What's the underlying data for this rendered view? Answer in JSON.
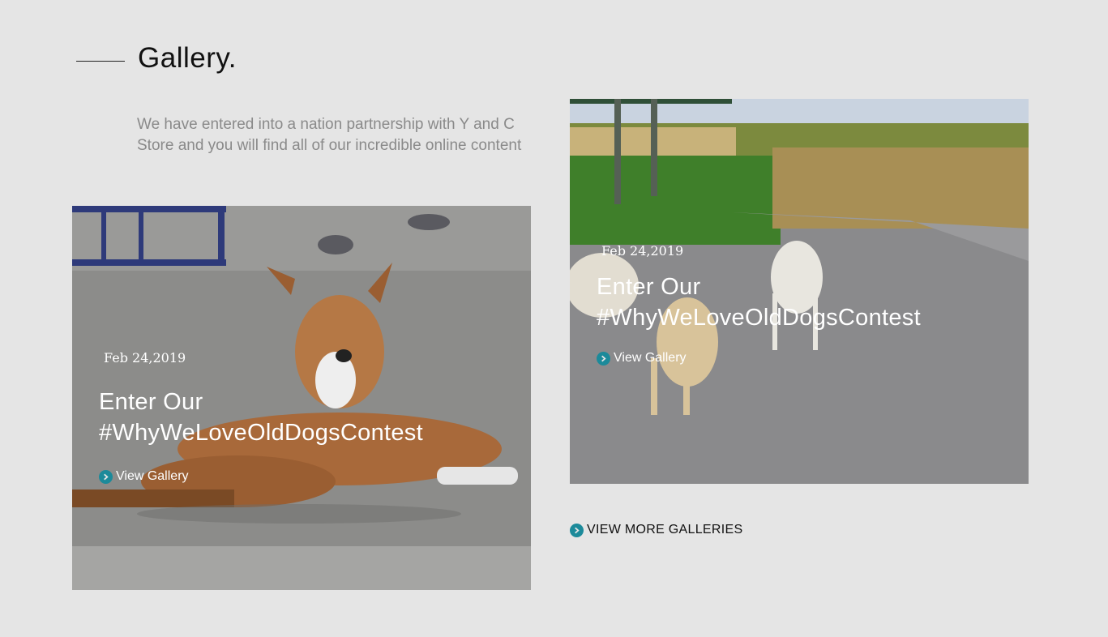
{
  "section": {
    "title": "Gallery.",
    "intro": "We have entered into a nation partnership with Y and C Store and you will find all of our incredible online content"
  },
  "cards": [
    {
      "date": "Feb 24,2019",
      "title_line1": "Enter Our",
      "title_line2": "#WhyWeLoveOldDogsContest",
      "link_label": "View Gallery",
      "photo": "brown-dog-lying-on-pavement"
    },
    {
      "date": "Feb 24,2019",
      "title_line1": "Enter Our",
      "title_line2": "#WhyWeLoveOldDogsContest",
      "link_label": "View Gallery",
      "photo": "stray-dogs-on-road"
    }
  ],
  "more_link": "VIEW MORE GALLERIES",
  "icons": {
    "link": "chevron-right-circle-icon"
  },
  "colors": {
    "background": "#e5e5e5",
    "accent": "#1c8a9a"
  }
}
